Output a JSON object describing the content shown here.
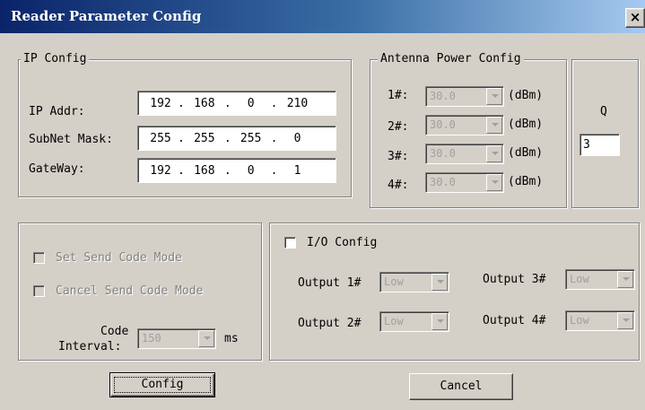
{
  "window": {
    "title": "Reader Parameter Config",
    "close_glyph": "×"
  },
  "ip_config": {
    "legend": "IP Config",
    "ip_addr": {
      "label": "IP Addr:",
      "octets": [
        "192",
        "168",
        "0",
        "210"
      ]
    },
    "subnet_mask": {
      "label": "SubNet Mask:",
      "octets": [
        "255",
        "255",
        "255",
        "0"
      ]
    },
    "gateway": {
      "label": "GateWay:",
      "octets": [
        "192",
        "168",
        "0",
        "1"
      ]
    },
    "separator": "."
  },
  "antenna_power": {
    "legend": "Antenna Power Config",
    "unit": "(dBm)",
    "items": [
      {
        "label": "1#:",
        "value": "30.0"
      },
      {
        "label": "2#:",
        "value": "30.0"
      },
      {
        "label": "3#:",
        "value": "30.0"
      },
      {
        "label": "4#:",
        "value": "30.0"
      }
    ]
  },
  "q_config": {
    "label": "Q",
    "value": "3"
  },
  "send_code": {
    "set_mode_label": "Set Send Code Mode",
    "cancel_mode_label": "Cancel Send Code Mode",
    "interval_label_line1": "Code",
    "interval_label_line2": "Interval:",
    "interval_value": "150",
    "interval_unit": "ms"
  },
  "io_config": {
    "label": "I/O Config",
    "outputs": [
      {
        "label": "Output 1#",
        "value": "Low"
      },
      {
        "label": "Output 2#",
        "value": "Low"
      },
      {
        "label": "Output 3#",
        "value": "Low"
      },
      {
        "label": "Output 4#",
        "value": "Low"
      }
    ]
  },
  "buttons": {
    "config": "Config",
    "cancel": "Cancel"
  },
  "colors": {
    "titlebar_start": "#0a246a",
    "titlebar_end": "#a6caf0",
    "dialog_bg": "#d4d0c8"
  }
}
